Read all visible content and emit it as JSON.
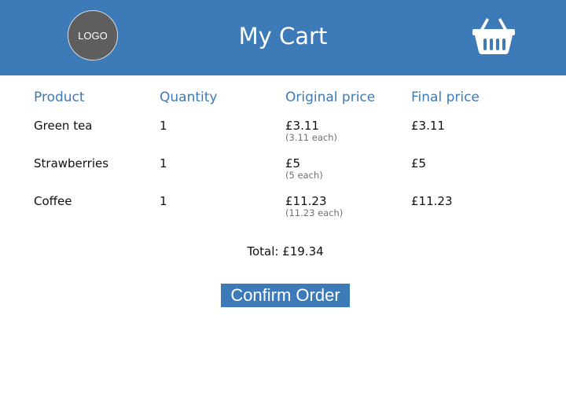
{
  "header": {
    "logo_text": "LOGO",
    "title": "My Cart",
    "basket_icon": "shopping-basket-icon",
    "background_color": "#3d7ab8"
  },
  "table": {
    "columns": [
      "Product",
      "Quantity",
      "Original price",
      "Final price"
    ],
    "rows": [
      {
        "product": "Green tea",
        "quantity": "1",
        "original_price": "£3.11",
        "unit_note": "(3.11 each)",
        "final_price": "£3.11"
      },
      {
        "product": "Strawberries",
        "quantity": "1",
        "original_price": "£5",
        "unit_note": "(5 each)",
        "final_price": "£5"
      },
      {
        "product": "Coffee",
        "quantity": "1",
        "original_price": "£11.23",
        "unit_note": "(11.23 each)",
        "final_price": "£11.23"
      }
    ]
  },
  "summary": {
    "total": "Total: £19.34"
  },
  "actions": {
    "confirm_label": "Confirm Order"
  },
  "colors": {
    "accent": "#3d7ab8",
    "logo_bg": "#5e5e5e",
    "muted_text": "#707070"
  }
}
